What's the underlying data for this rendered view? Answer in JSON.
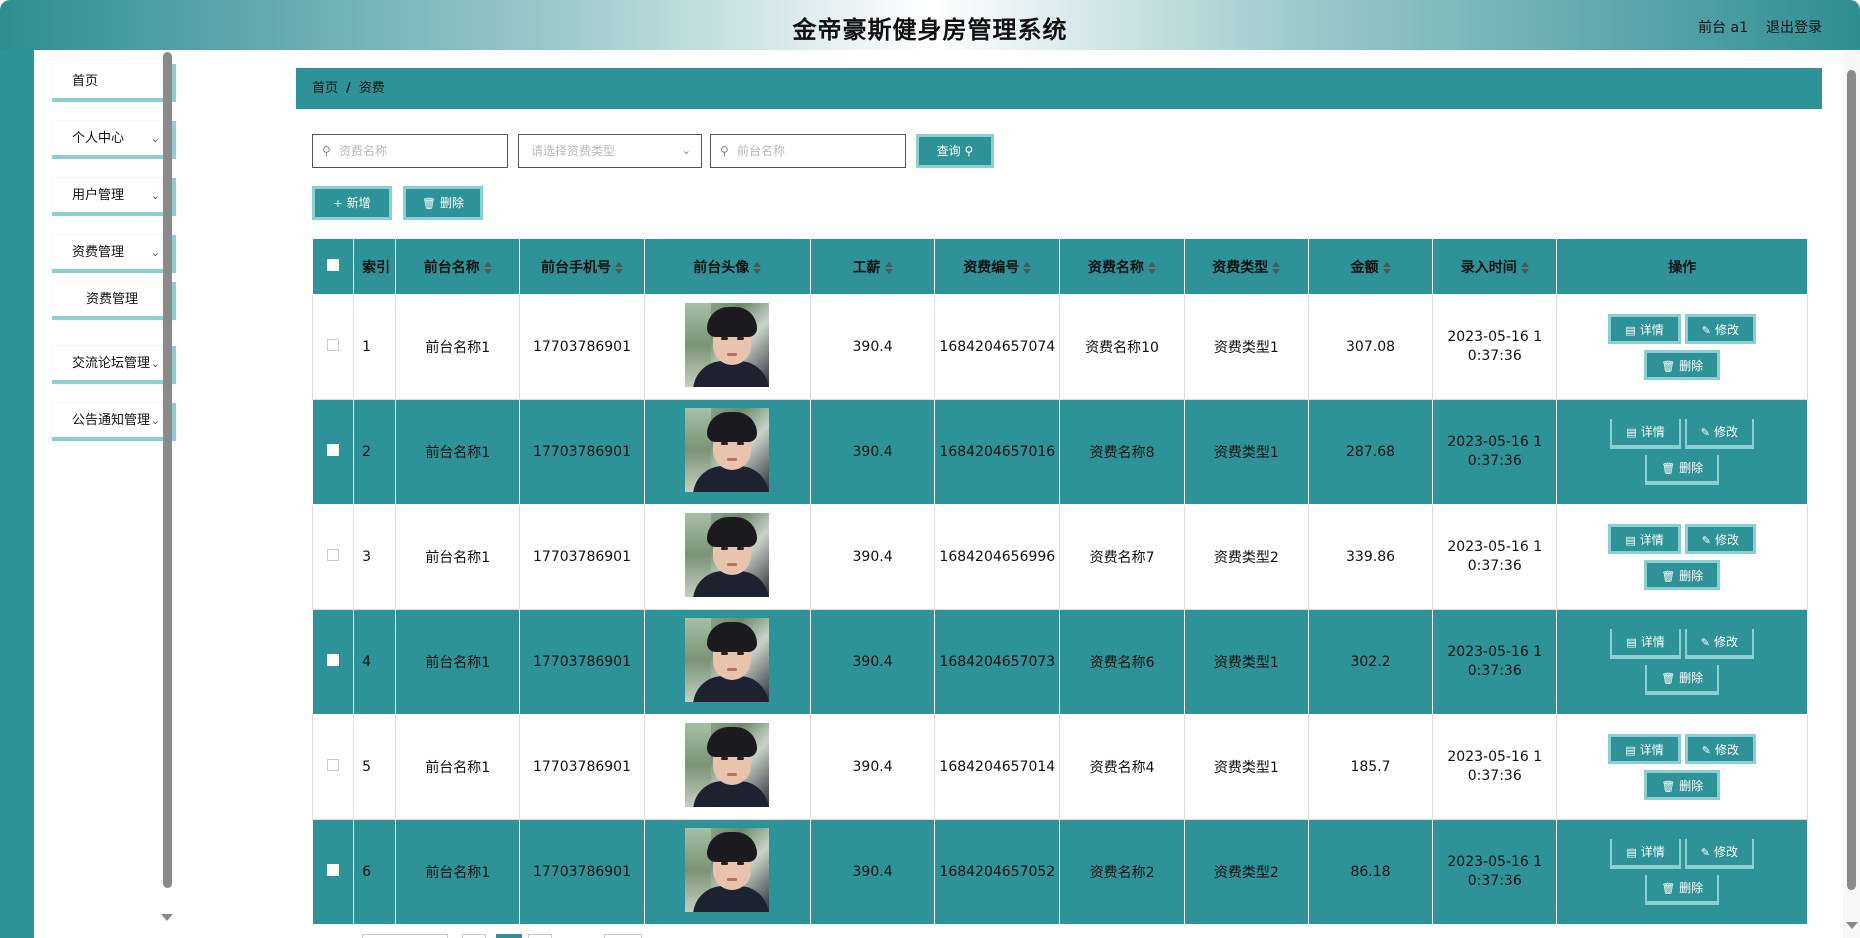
{
  "header": {
    "title": "金帝豪斯健身房管理系统",
    "user": "前台 a1",
    "logout": "退出登录"
  },
  "sidebar": {
    "items": [
      {
        "label": "首页",
        "has_arrow": false
      },
      {
        "label": "个人中心",
        "has_arrow": true
      },
      {
        "label": "用户管理",
        "has_arrow": true
      },
      {
        "label": "资费管理",
        "has_arrow": true
      },
      {
        "label": "交流论坛管理",
        "has_arrow": true
      },
      {
        "label": "公告通知管理",
        "has_arrow": true
      }
    ],
    "subitem": "资费管理"
  },
  "breadcrumb": {
    "home": "首页",
    "separator": "/",
    "current": "资费"
  },
  "search": {
    "name_placeholder": "资费名称",
    "type_placeholder": "请选择资费类型",
    "frontdesk_placeholder": "前台名称",
    "query_label": "查询"
  },
  "toolbar": {
    "add_label": "新增",
    "delete_label": "删除"
  },
  "table": {
    "headers": {
      "index": "索引",
      "name": "前台名称",
      "phone": "前台手机号",
      "avatar": "前台头像",
      "salary": "工薪",
      "fee_no": "资费编号",
      "fee_name": "资费名称",
      "fee_type": "资费类型",
      "amount": "金额",
      "time": "录入时间",
      "ops": "操作"
    },
    "row_buttons": {
      "detail": "详情",
      "edit": "修改",
      "delete": "删除"
    },
    "rows": [
      {
        "index": "1",
        "name": "前台名称1",
        "phone": "17703786901",
        "salary": "390.4",
        "fee_no": "1684204657074",
        "fee_name": "资费名称10",
        "fee_type": "资费类型1",
        "amount": "307.08",
        "time": "2023-05-16 10:37:36"
      },
      {
        "index": "2",
        "name": "前台名称1",
        "phone": "17703786901",
        "salary": "390.4",
        "fee_no": "1684204657016",
        "fee_name": "资费名称8",
        "fee_type": "资费类型1",
        "amount": "287.68",
        "time": "2023-05-16 10:37:36"
      },
      {
        "index": "3",
        "name": "前台名称1",
        "phone": "17703786901",
        "salary": "390.4",
        "fee_no": "1684204656996",
        "fee_name": "资费名称7",
        "fee_type": "资费类型2",
        "amount": "339.86",
        "time": "2023-05-16 10:37:36"
      },
      {
        "index": "4",
        "name": "前台名称1",
        "phone": "17703786901",
        "salary": "390.4",
        "fee_no": "1684204657073",
        "fee_name": "资费名称6",
        "fee_type": "资费类型1",
        "amount": "302.2",
        "time": "2023-05-16 10:37:36"
      },
      {
        "index": "5",
        "name": "前台名称1",
        "phone": "17703786901",
        "salary": "390.4",
        "fee_no": "1684204657014",
        "fee_name": "资费名称4",
        "fee_type": "资费类型1",
        "amount": "185.7",
        "time": "2023-05-16 10:37:36"
      },
      {
        "index": "6",
        "name": "前台名称1",
        "phone": "17703786901",
        "salary": "390.4",
        "fee_no": "1684204657052",
        "fee_name": "资费名称2",
        "fee_type": "资费类型2",
        "amount": "86.18",
        "time": "2023-05-16 10:37:36"
      }
    ]
  },
  "colors": {
    "primary": "#2e9398",
    "accent_border": "#8ccfd3"
  }
}
